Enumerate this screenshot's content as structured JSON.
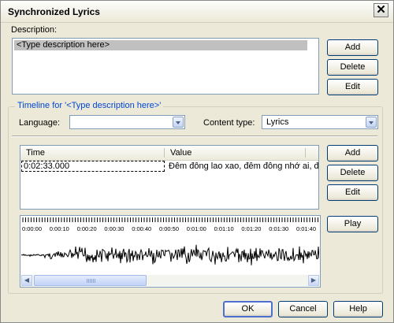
{
  "window": {
    "title": "Synchronized Lyrics"
  },
  "description_section": {
    "label": "Description:",
    "items": [
      "<Type description here>"
    ],
    "buttons": {
      "add": "Add",
      "delete": "Delete",
      "edit": "Edit"
    }
  },
  "timeline": {
    "group_label": "Timeline for '<Type description here>'",
    "language_label": "Language:",
    "language_value": "",
    "content_type_label": "Content type:",
    "content_type_value": "Lyrics",
    "columns": [
      "Time",
      "Value"
    ],
    "rows": [
      {
        "time": "0:02:33.000",
        "value": "Đêm đông lao xao, đêm đông nhớ ai, đêm"
      }
    ],
    "buttons": {
      "add": "Add",
      "delete": "Delete",
      "edit": "Edit",
      "play": "Play"
    },
    "ruler_labels": [
      "0:00:00",
      "0:00:10",
      "0:00:20",
      "0:00:30",
      "0:00:40",
      "0:00:50",
      "0:01:00",
      "0:01:10",
      "0:01:20",
      "0:01:30",
      "0:01:40"
    ]
  },
  "footer_buttons": {
    "ok": "OK",
    "cancel": "Cancel",
    "help": "Help"
  },
  "colors": {
    "accent": "#0046d5",
    "selection": "#c0c0c0",
    "dialog_bg": "#ece9d8"
  }
}
